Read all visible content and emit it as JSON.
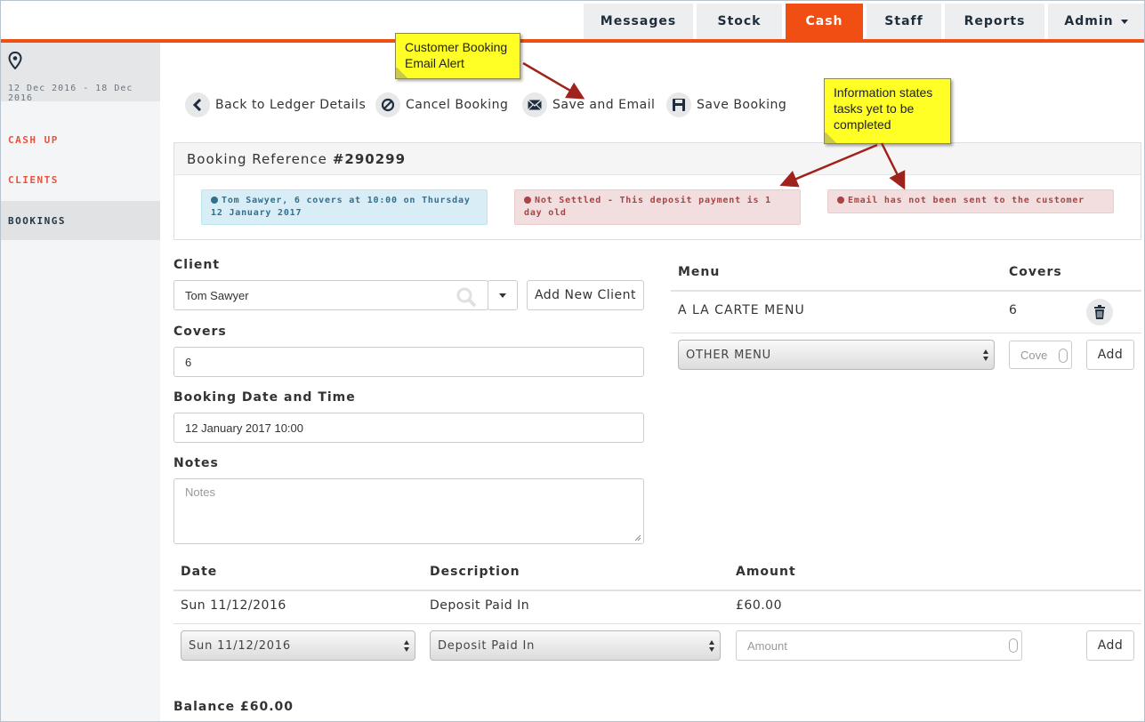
{
  "nav": {
    "tabs": [
      {
        "label": "Messages"
      },
      {
        "label": "Stock"
      },
      {
        "label": "Cash"
      },
      {
        "label": "Staff"
      },
      {
        "label": "Reports"
      },
      {
        "label": "Admin"
      }
    ],
    "active_tab": "Cash",
    "accent_color": "#f04e12"
  },
  "sidebar": {
    "date_range": "12 Dec 2016 - 18 Dec 2016",
    "items": [
      {
        "label": "CASH UP"
      },
      {
        "label": "CLIENTS"
      },
      {
        "label": "BOOKINGS"
      }
    ]
  },
  "toolbar": {
    "back_label": "Back to Ledger Details",
    "cancel_label": "Cancel Booking",
    "save_email_label": "Save and Email",
    "save_label": "Save Booking"
  },
  "booking": {
    "ref_label": "Booking Reference",
    "ref_number": "#290299",
    "alerts": {
      "info": "Tom Sawyer, 6 covers at 10:00 on Thursday 12 January 2017",
      "not_settled": "Not Settled - This deposit payment is 1 day old",
      "email": "Email has not been sent to the customer"
    }
  },
  "form": {
    "client_label": "Client",
    "client_value": "Tom Sawyer",
    "add_client_label": "Add New Client",
    "covers_label": "Covers",
    "covers_value": "6",
    "datetime_label": "Booking Date and Time",
    "datetime_value": "12 January 2017 10:00",
    "notes_label": "Notes",
    "notes_placeholder": "Notes"
  },
  "menu_table": {
    "col_menu": "Menu",
    "col_covers": "Covers",
    "rows": [
      {
        "menu": "A LA CARTE MENU",
        "covers": "6"
      }
    ],
    "new_menu_select": "OTHER MENU",
    "new_covers_placeholder": "Cove",
    "add_label": "Add"
  },
  "payments": {
    "col_date": "Date",
    "col_description": "Description",
    "col_amount": "Amount",
    "rows": [
      {
        "date": "Sun 11/12/2016",
        "description": "Deposit Paid In",
        "amount": "£60.00"
      }
    ],
    "new_date_select": "Sun 11/12/2016",
    "new_description_select": "Deposit Paid In",
    "amount_placeholder": "Amount",
    "add_label": "Add",
    "balance": "Balance £60.00"
  },
  "callouts": {
    "email_alert": "Customer Booking Email Alert",
    "tasks": "Information states tasks yet to be completed"
  }
}
